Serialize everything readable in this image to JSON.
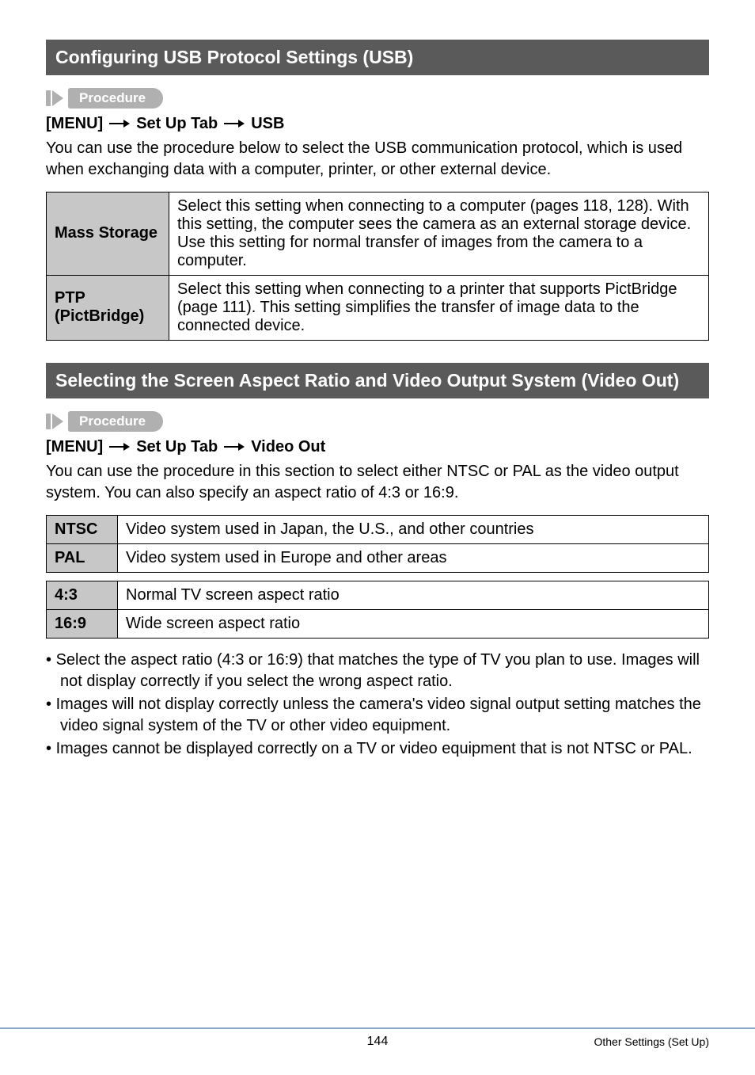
{
  "section1": {
    "title": "Configuring USB Protocol Settings (USB)",
    "procedure_label": "Procedure",
    "menu": {
      "p1": "[MENU]",
      "p2": "Set Up Tab",
      "p3": "USB"
    },
    "intro": "You can use the procedure below to select the USB communication protocol, which is used when exchanging data with a computer, printer, or other external device.",
    "rows": [
      {
        "label": "Mass Storage",
        "desc": "Select this setting when connecting to a computer (pages 118, 128). With this setting, the computer sees the camera as an external storage device. Use this setting for normal transfer of images from the camera to a computer."
      },
      {
        "label": "PTP (PictBridge)",
        "desc": "Select this setting when connecting to a printer that supports PictBridge (page 111). This setting simplifies the transfer of image data to the connected device."
      }
    ]
  },
  "section2": {
    "title": "Selecting the Screen Aspect Ratio and Video Output System (Video Out)",
    "procedure_label": "Procedure",
    "menu": {
      "p1": "[MENU]",
      "p2": "Set Up Tab",
      "p3": "Video Out"
    },
    "intro": "You can use the procedure in this section to select either NTSC or PAL as the video output system. You can also specify an aspect ratio of 4:3 or 16:9.",
    "tableA": [
      {
        "label": "NTSC",
        "desc": "Video system used in Japan, the U.S., and other countries"
      },
      {
        "label": "PAL",
        "desc": "Video system used in Europe and other areas"
      }
    ],
    "tableB": [
      {
        "label": "4:3",
        "desc": "Normal TV screen aspect ratio"
      },
      {
        "label": "16:9",
        "desc": "Wide screen aspect ratio"
      }
    ],
    "notes": [
      "Select the aspect ratio (4:3 or 16:9) that matches the type of TV you plan to use. Images will not display correctly if you select the wrong aspect ratio.",
      "Images will not display correctly unless the camera's video signal output setting matches the video signal system of the TV or other video equipment.",
      "Images cannot be displayed correctly on a TV or video equipment that is not NTSC or PAL."
    ]
  },
  "footer": {
    "page": "144",
    "right": "Other Settings (Set Up)"
  }
}
